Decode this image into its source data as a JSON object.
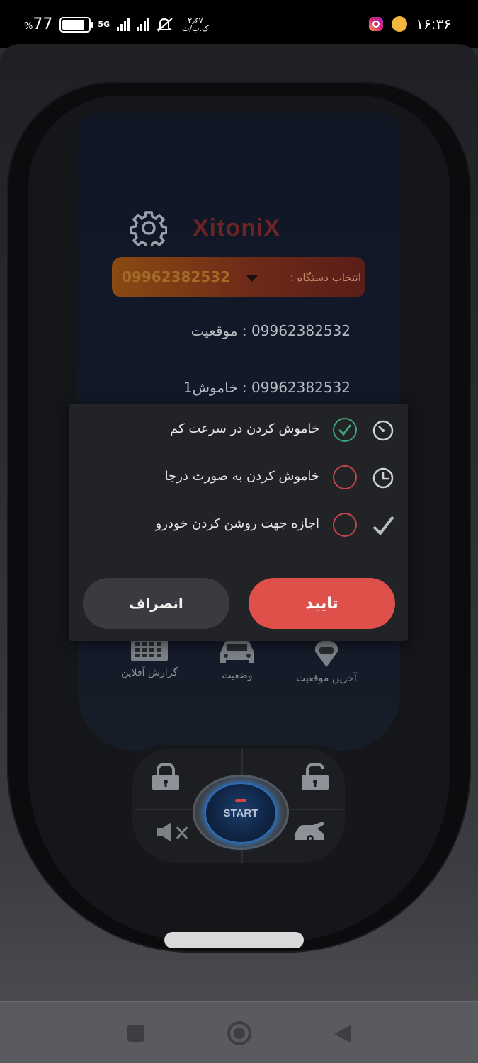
{
  "status_bar": {
    "battery_percent": "77",
    "battery_sign": "%",
    "network": "5G",
    "speed_value": "۲٫۶۷",
    "speed_unit": "ک.ب/ث",
    "time": "۱۶:۳۶"
  },
  "app": {
    "logo_text": "XitoniX",
    "device_selector": {
      "label": "انتخاب دستگاه :",
      "value": "09962382532"
    },
    "info_lines": [
      "09962382532 : موقعیت",
      "09962382532 : خاموش1"
    ],
    "menu": [
      {
        "label": "آخرین موقعیت",
        "icon": "location-car-icon"
      },
      {
        "label": "وضعیت",
        "icon": "car-icon"
      },
      {
        "label": "گزارش آفلاین",
        "icon": "keypad-icon"
      }
    ],
    "start_label": "START"
  },
  "dialog": {
    "options": [
      {
        "label": "خاموش کردن در سرعت کم",
        "icon": "speedometer-icon",
        "checked": true
      },
      {
        "label": "خاموش کردن به صورت درجا",
        "icon": "clock-icon",
        "checked": false
      },
      {
        "label": "اجازه جهت روشن کردن خودرو",
        "icon": "checkmark-icon",
        "checked": false
      }
    ],
    "confirm_label": "تایید",
    "cancel_label": "انصراف"
  },
  "colors": {
    "accent_red": "#e0504b",
    "check_green": "#3fa37a",
    "dialog_bg": "#222326"
  }
}
